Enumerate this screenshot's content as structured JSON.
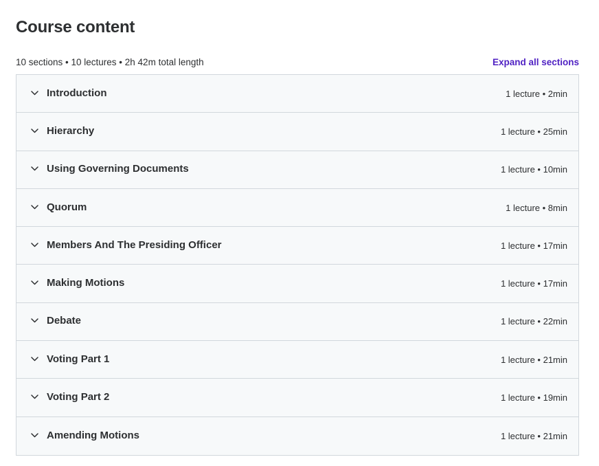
{
  "header": {
    "title": "Course content"
  },
  "summary": {
    "text": "10 sections • 10 lectures • 2h 42m total length",
    "expand_label": "Expand all sections"
  },
  "colors": {
    "link": "#5022c3",
    "panel_bg": "#f7f9fa",
    "border": "#d1d7dc",
    "text": "#2d2f31"
  },
  "sections": [
    {
      "title": "Introduction",
      "meta": "1 lecture • 2min",
      "icon": "chevron-down-icon"
    },
    {
      "title": "Hierarchy",
      "meta": "1 lecture • 25min",
      "icon": "chevron-down-icon"
    },
    {
      "title": "Using Governing Documents",
      "meta": "1 lecture • 10min",
      "icon": "chevron-down-icon"
    },
    {
      "title": "Quorum",
      "meta": "1 lecture • 8min",
      "icon": "chevron-down-icon"
    },
    {
      "title": "Members And The Presiding Officer",
      "meta": "1 lecture • 17min",
      "icon": "chevron-down-icon"
    },
    {
      "title": "Making Motions",
      "meta": "1 lecture • 17min",
      "icon": "chevron-down-icon"
    },
    {
      "title": "Debate",
      "meta": "1 lecture • 22min",
      "icon": "chevron-down-icon"
    },
    {
      "title": "Voting Part 1",
      "meta": "1 lecture • 21min",
      "icon": "chevron-down-icon"
    },
    {
      "title": "Voting Part 2",
      "meta": "1 lecture • 19min",
      "icon": "chevron-down-icon"
    },
    {
      "title": "Amending Motions",
      "meta": "1 lecture • 21min",
      "icon": "chevron-down-icon"
    }
  ]
}
